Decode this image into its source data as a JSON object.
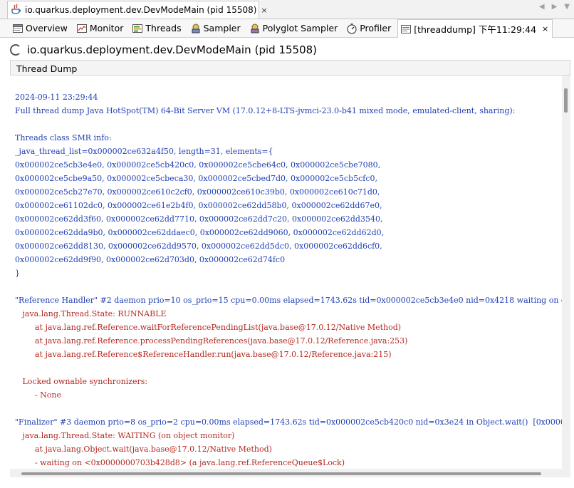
{
  "document_tab": {
    "title": "io.quarkus.deployment.dev.DevModeMain (pid 15508)",
    "close_glyph": "×"
  },
  "strip_nav": {
    "left": "◀",
    "right": "▶",
    "menu": "▼"
  },
  "view_tabs": [
    {
      "label": "Overview",
      "icon": "overview-icon"
    },
    {
      "label": "Monitor",
      "icon": "monitor-icon"
    },
    {
      "label": "Threads",
      "icon": "threads-icon"
    },
    {
      "label": "Sampler",
      "icon": "sampler-icon"
    },
    {
      "label": "Polyglot Sampler",
      "icon": "polyglot-sampler-icon"
    },
    {
      "label": "Profiler",
      "icon": "profiler-icon"
    },
    {
      "label": "[threaddump] 下午11:29:44",
      "icon": "threaddump-icon",
      "active": true,
      "close": "×"
    }
  ],
  "header": {
    "process_name": "io.quarkus.deployment.dev.DevModeMain",
    "pid": "(pid 15508)"
  },
  "panel": {
    "title": "Thread Dump"
  },
  "dump_lines": [
    {
      "text": "2024-09-11 23:29:44",
      "color": "blue"
    },
    {
      "text": "Full thread dump Java HotSpot(TM) 64-Bit Server VM (17.0.12+8-LTS-jvmci-23.0-b41 mixed mode, emulated-client, sharing):",
      "color": "blue"
    },
    {
      "text": "",
      "color": "blue"
    },
    {
      "text": "Threads class SMR info:",
      "color": "blue"
    },
    {
      "text": "_java_thread_list=0x000002ce632a4f50, length=31, elements={",
      "color": "blue"
    },
    {
      "text": "0x000002ce5cb3e4e0, 0x000002ce5cb420c0, 0x000002ce5cbe64c0, 0x000002ce5cbe7080,",
      "color": "blue"
    },
    {
      "text": "0x000002ce5cbe9a50, 0x000002ce5cbeca30, 0x000002ce5cbed7d0, 0x000002ce5cb5cfc0,",
      "color": "blue"
    },
    {
      "text": "0x000002ce5cb27e70, 0x000002ce610c2cf0, 0x000002ce610c39b0, 0x000002ce610c71d0,",
      "color": "blue"
    },
    {
      "text": "0x000002ce61102dc0, 0x000002ce61e2b4f0, 0x000002ce62dd58b0, 0x000002ce62dd67e0,",
      "color": "blue"
    },
    {
      "text": "0x000002ce62dd3f60, 0x000002ce62dd7710, 0x000002ce62dd7c20, 0x000002ce62dd3540,",
      "color": "blue"
    },
    {
      "text": "0x000002ce62dda9b0, 0x000002ce62ddaec0, 0x000002ce62dd9060, 0x000002ce62dd62d0,",
      "color": "blue"
    },
    {
      "text": "0x000002ce62dd8130, 0x000002ce62dd9570, 0x000002ce62dd5dc0, 0x000002ce62dd6cf0,",
      "color": "blue"
    },
    {
      "text": "0x000002ce62dd9f90, 0x000002ce62d703d0, 0x000002ce62d74fc0",
      "color": "blue"
    },
    {
      "text": "}",
      "color": "blue"
    },
    {
      "text": "",
      "color": "blue"
    },
    {
      "text": "\"Reference Handler\" #2 daemon prio=10 os_prio=15 cpu=0.00ms elapsed=1743.62s tid=0x000002ce5cb3e4e0 nid=0x4218 waiting on condi",
      "color": "blue"
    },
    {
      "text": "   java.lang.Thread.State: RUNNABLE",
      "color": "red"
    },
    {
      "text": "        at java.lang.ref.Reference.waitForReferencePendingList(java.base@17.0.12/Native Method)",
      "color": "red"
    },
    {
      "text": "        at java.lang.ref.Reference.processPendingReferences(java.base@17.0.12/Reference.java:253)",
      "color": "red"
    },
    {
      "text": "        at java.lang.ref.Reference$ReferenceHandler.run(java.base@17.0.12/Reference.java:215)",
      "color": "red"
    },
    {
      "text": "",
      "color": "red"
    },
    {
      "text": "   Locked ownable synchronizers:",
      "color": "red"
    },
    {
      "text": "        - None",
      "color": "red"
    },
    {
      "text": "",
      "color": "red"
    },
    {
      "text": "\"Finalizer\" #3 daemon prio=8 os_prio=2 cpu=0.00ms elapsed=1743.62s tid=0x000002ce5cb420c0 nid=0x3e24 in Object.wait()  [0x000000",
      "color": "blue"
    },
    {
      "text": "   java.lang.Thread.State: WAITING (on object monitor)",
      "color": "red"
    },
    {
      "text": "        at java.lang.Object.wait(java.base@17.0.12/Native Method)",
      "color": "red"
    },
    {
      "text": "        - waiting on <0x0000000703b428d8> (a java.lang.ref.ReferenceQueue$Lock)",
      "color": "red"
    }
  ],
  "colors": {
    "blue": "#1f3fb5",
    "red": "#b22820"
  }
}
